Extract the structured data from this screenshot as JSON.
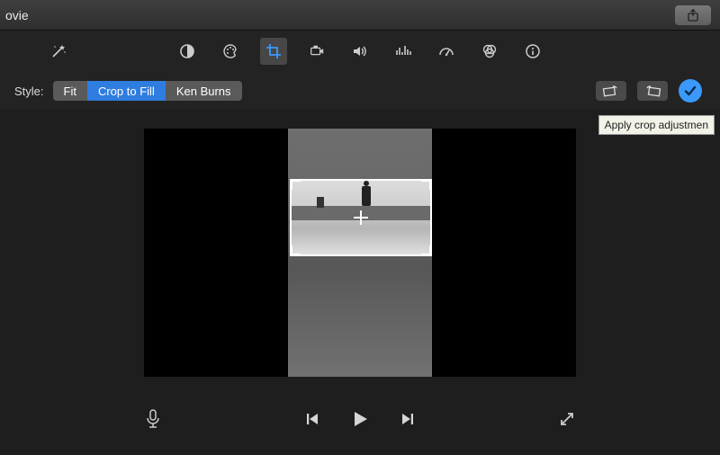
{
  "titlebar": {
    "title": "ovie"
  },
  "toolbar": {
    "icons": [
      "wand",
      "color-balance",
      "color-correction",
      "crop",
      "stabilization",
      "volume",
      "equalizer",
      "speed",
      "filters",
      "info"
    ],
    "active": "crop"
  },
  "cropbar": {
    "style_label": "Style:",
    "options": [
      "Fit",
      "Crop to Fill",
      "Ken Burns"
    ],
    "selected": "Crop to Fill",
    "rotate_buttons": [
      "rotate-ccw",
      "rotate-cw"
    ],
    "apply_tooltip": "Apply crop adjustmen"
  },
  "transport": {
    "buttons": [
      "voiceover",
      "previous",
      "play",
      "next",
      "fullscreen"
    ]
  },
  "colors": {
    "accent": "#3b99fc",
    "background": "#1e1e1e",
    "toolbar": "#232323",
    "segment": "#5a5a5a"
  }
}
